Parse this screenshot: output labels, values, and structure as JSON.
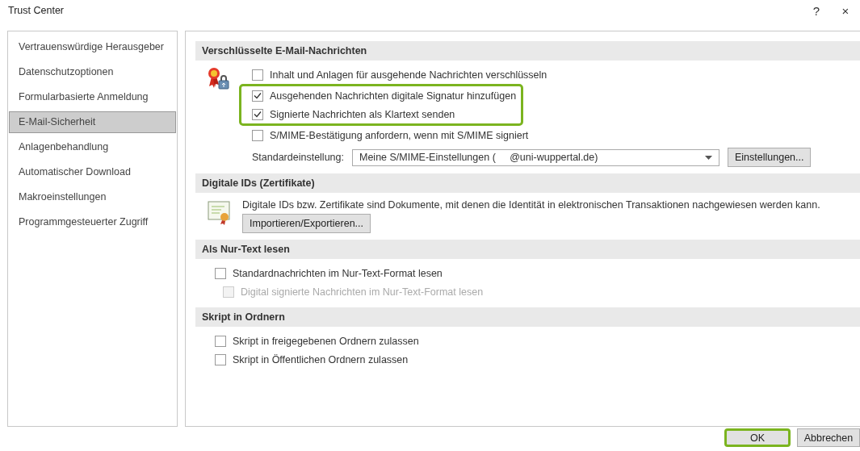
{
  "window": {
    "title": "Trust Center",
    "help": "?",
    "close": "×"
  },
  "sidebar": {
    "items": [
      {
        "label": "Vertrauenswürdige Herausgeber",
        "selected": false
      },
      {
        "label": "Datenschutzoptionen",
        "selected": false
      },
      {
        "label": "Formularbasierte Anmeldung",
        "selected": false
      },
      {
        "label": "E-Mail-Sicherheit",
        "selected": true
      },
      {
        "label": "Anlagenbehandlung",
        "selected": false
      },
      {
        "label": "Automatischer Download",
        "selected": false
      },
      {
        "label": "Makroeinstellungen",
        "selected": false
      },
      {
        "label": "Programmgesteuerter Zugriff",
        "selected": false
      }
    ]
  },
  "sections": [
    {
      "title": "Verschlüsselte E-Mail-Nachrichten",
      "kind": "encryption",
      "items": [
        {
          "kind": "checkbox",
          "label": "Inhalt und Anlagen für ausgehende Nachrichten verschlüsseln",
          "checked": false
        },
        {
          "kind": "checkbox",
          "label": "Ausgehenden Nachrichten digitale Signatur hinzufügen",
          "checked": true,
          "highlighted": true
        },
        {
          "kind": "checkbox",
          "label": "Signierte Nachrichten als Klartext senden",
          "checked": true,
          "highlighted": true
        },
        {
          "kind": "checkbox",
          "label": "S/MIME-Bestätigung anfordern, wenn mit S/MIME signiert",
          "checked": false
        },
        {
          "kind": "select",
          "label": "Standardeinstellung:",
          "value": "Meine S/MIME-Einstellungen (     @uni-wuppertal.de)",
          "button": "Einstellungen..."
        }
      ]
    },
    {
      "title": "Digitale IDs (Zertifikate)",
      "kind": "certificates",
      "items": [
        {
          "kind": "description",
          "text": "Digitale IDs bzw. Zertifikate sind Dokumente, mit denen die Identität in elektronischen Transaktionen nachgewiesen werden kann.",
          "button": "Importieren/Exportieren..."
        }
      ]
    },
    {
      "title": "Als Nur-Text lesen",
      "kind": "plain",
      "items": [
        {
          "kind": "checkbox",
          "label": "Standardnachrichten im Nur-Text-Format lesen",
          "checked": false,
          "children": [
            {
              "label": "Digital signierte Nachrichten im Nur-Text-Format lesen",
              "checked": false,
              "disabled": true
            }
          ]
        }
      ]
    },
    {
      "title": "Skript in Ordnern",
      "kind": "plain",
      "items": [
        {
          "kind": "checkbox",
          "label": "Skript in freigegebenen Ordnern zulassen",
          "checked": false
        },
        {
          "kind": "checkbox",
          "label": "Skript in Öffentlichen Ordnern zulassen",
          "checked": false
        }
      ]
    }
  ],
  "buttons": [
    {
      "label": "OK",
      "highlighted": true
    },
    {
      "label": "Abbrechen",
      "highlighted": false
    }
  ]
}
